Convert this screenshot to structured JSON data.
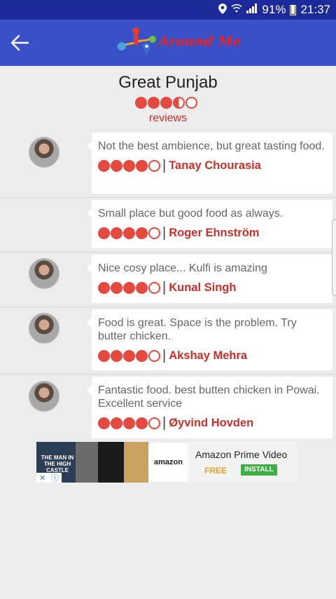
{
  "status_bar": {
    "battery_percent": "91%",
    "time": "21:37",
    "icons": [
      "location-icon",
      "wifi-icon",
      "signal-icon",
      "battery-icon"
    ]
  },
  "app_bar": {
    "logo_text": "Around Me",
    "back_icon": "back-arrow-icon"
  },
  "restaurant": {
    "name": "Great Punjab",
    "rating": 3.5,
    "rating_max": 5,
    "reviews_label": "reviews"
  },
  "reviews": [
    {
      "text": "Not the best ambience, but great tasting food.",
      "author": "Tanay Chourasia",
      "rating": 4,
      "has_avatar": true
    },
    {
      "text": "Small place but good food as always.",
      "author": "Roger Ehnström",
      "rating": 4,
      "has_avatar": false
    },
    {
      "text": "Nice cosy place... Kulfi is amazing",
      "author": "Kunal Singh",
      "rating": 4,
      "has_avatar": true
    },
    {
      "text": "Food is great. Space is the problem. Try butter chicken.",
      "author": "Akshay Mehra",
      "rating": 4,
      "has_avatar": true
    },
    {
      "text": "Fantastic food. best butten chicken in Powai. Excellent service",
      "author": "Øyvind Hovden",
      "rating": 4,
      "has_avatar": true
    }
  ],
  "separator": "|",
  "ad": {
    "image_text": "THE MAN IN THE HIGH CASTLE",
    "brand": "amazon",
    "title": "Amazon Prime Video",
    "price": "FREE",
    "install_label": "INSTALL"
  },
  "colors": {
    "status_bar": "#1d2a9a",
    "app_bar": "#3a50c6",
    "accent_red": "#e44a40",
    "author_red": "#c8312c"
  }
}
